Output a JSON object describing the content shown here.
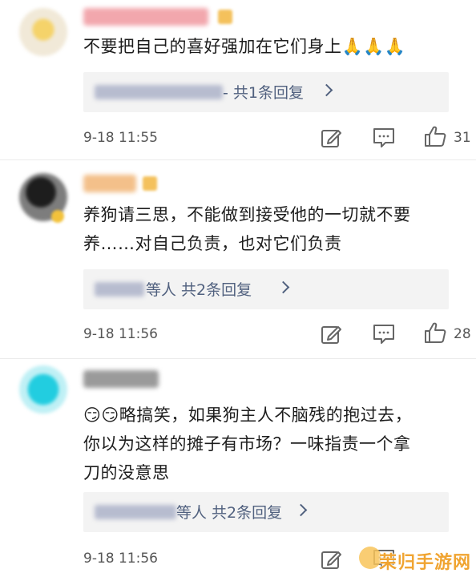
{
  "comments": [
    {
      "text_lines": [
        "不要把自己的喜好强加在它们身上🙏🙏🙏"
      ],
      "reply_suffix": "- 共1条回复",
      "time": "9-18 11:55",
      "likes": "31"
    },
    {
      "text_lines": [
        "养狗请三思，不能做到接受他的一切就不要",
        "养……对自己负责，也对它们负责"
      ],
      "reply_suffix": "等人  共2条回复",
      "time": "9-18 11:56",
      "likes": "28"
    },
    {
      "text_lines": [
        "😏😏略搞笑，如果狗主人不脑残的抱过去，",
        "你以为这样的摊子有市场？一味指责一个拿",
        "刀的没意思"
      ],
      "reply_suffix": "等人  共2条回复",
      "time": "9-18 11:56",
      "likes": ""
    }
  ],
  "icons": {
    "edit": "edit-icon",
    "comment": "comment-icon",
    "like": "thumbs-up-icon",
    "chevron": "chevron-right-icon"
  },
  "watermark": {
    "text": "茉归手游网"
  },
  "colors": {
    "link": "#51617f",
    "reply_bg": "#f3f3f3",
    "watermark": "#f0a431"
  }
}
